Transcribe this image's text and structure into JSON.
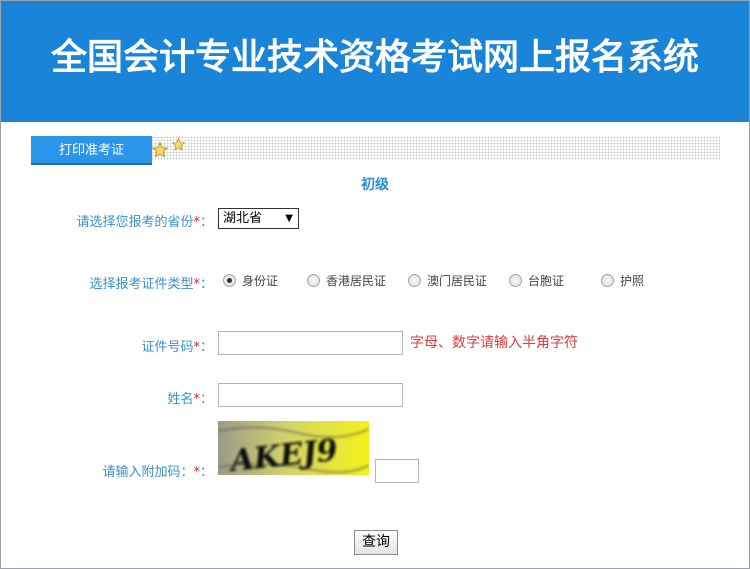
{
  "header": {
    "title": "全国会计专业技术资格考试网上报名系统",
    "bg_color": "#1a84d8"
  },
  "tabs": [
    {
      "label": "打印准考证",
      "active": true
    }
  ],
  "level": "初级",
  "form": {
    "province": {
      "label": "请选择您报考的省份",
      "required_mark": "*",
      "value": "湖北省"
    },
    "id_type": {
      "label": "选择报考证件类型",
      "required_mark": "*",
      "options": [
        {
          "label": "身份证",
          "checked": true
        },
        {
          "label": "香港居民证",
          "checked": false
        },
        {
          "label": "澳门居民证",
          "checked": false
        },
        {
          "label": "台胞证",
          "checked": false
        },
        {
          "label": "护照",
          "checked": false
        }
      ]
    },
    "id_number": {
      "label": "证件号码",
      "required_mark": "*",
      "value": "",
      "hint": "字母、数字请输入半角字符"
    },
    "name": {
      "label": "姓名",
      "required_mark": "*",
      "value": ""
    },
    "captcha": {
      "label": "请输入附加码：",
      "required_mark": "*",
      "image_text": "AKEJ9",
      "value": ""
    },
    "submit_label": "查询"
  },
  "colors": {
    "accent": "#2b95ea",
    "label": "#3b8fd1",
    "required": "#e02020",
    "hint": "#e03c3c"
  }
}
